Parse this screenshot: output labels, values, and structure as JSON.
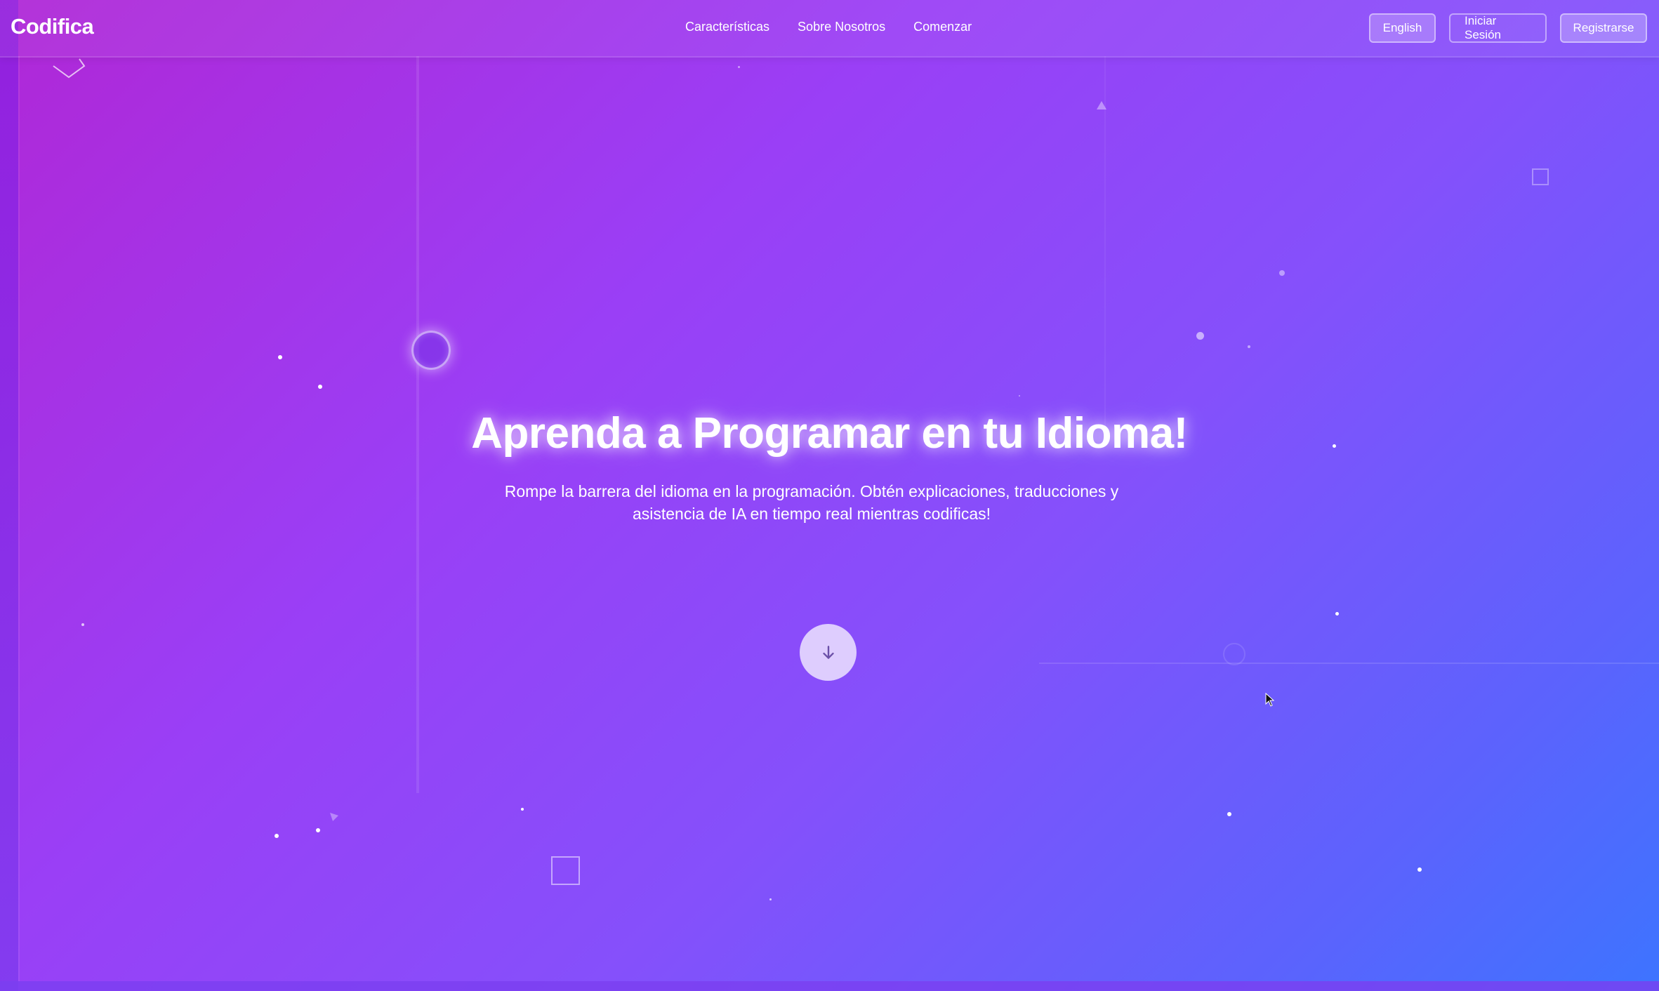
{
  "header": {
    "logo": "Codifica",
    "nav": [
      "Características",
      "Sobre Nosotros",
      "Comenzar"
    ],
    "language_button": "English",
    "login_button": "Iniciar Sesión",
    "signup_button": "Registrarse"
  },
  "hero": {
    "title": "Aprenda a Programar en tu Idioma!",
    "subtitle_line1": "Rompe la barrera del idioma en la programación. Obtén explicaciones, traducciones y",
    "subtitle_line2": "asistencia de IA en tiempo real mientras codificas!",
    "scroll_icon": "arrow-down-icon"
  },
  "colors": {
    "gradient_start": "#b027d6",
    "gradient_mid": "#9a3ff6",
    "gradient_end": "#3d74ff",
    "text": "#ffffff"
  }
}
